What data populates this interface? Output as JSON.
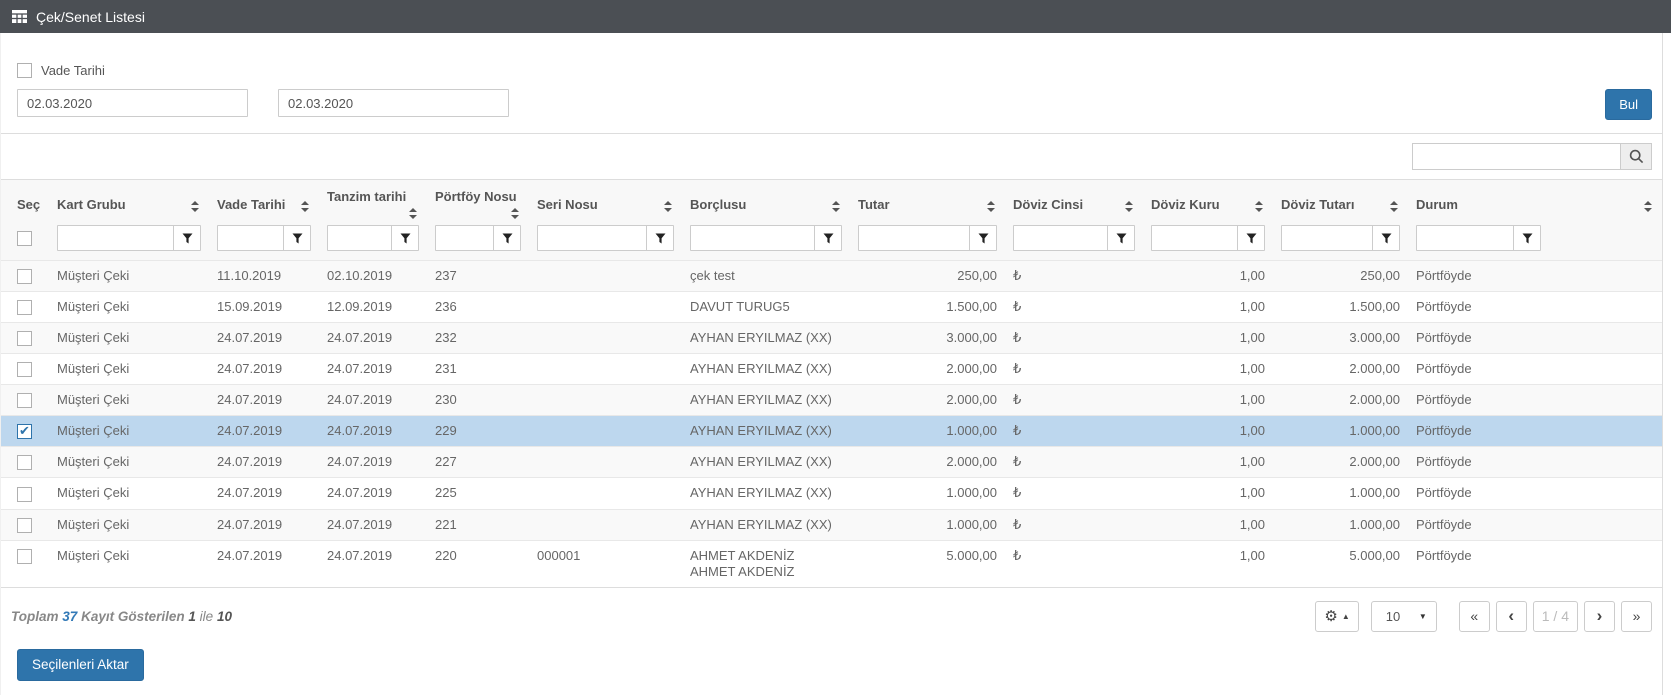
{
  "titlebar": {
    "title": "Çek/Senet Listesi",
    "icon": "table-icon",
    "bg_color": "#4b4f54"
  },
  "filters": {
    "vade_tarihi_label": "Vade Tarihi",
    "vade_tarihi_checked": false,
    "date_from": "02.03.2020",
    "date_to": "02.03.2020",
    "find_button": "Bul"
  },
  "search": {
    "value": "",
    "icon": "magnifier-icon"
  },
  "table": {
    "columns": [
      {
        "label": "Seç",
        "field": "sec",
        "sortable": false
      },
      {
        "label": "Kart Grubu",
        "field": "kart_grubu",
        "sortable": true
      },
      {
        "label": "Vade Tarihi",
        "field": "vade_tarihi",
        "sortable": true
      },
      {
        "label": "Tanzim tarihi",
        "field": "tanzim_tarihi",
        "sortable": true
      },
      {
        "label": "Pörtföy Nosu",
        "field": "portfoy_nosu",
        "sortable": true
      },
      {
        "label": "Seri Nosu",
        "field": "seri_nosu",
        "sortable": true
      },
      {
        "label": "Borçlusu",
        "field": "borclusu",
        "sortable": true
      },
      {
        "label": "Tutar",
        "field": "tutar",
        "sortable": true
      },
      {
        "label": "Döviz Cinsi",
        "field": "doviz_cinsi",
        "sortable": true
      },
      {
        "label": "Döviz Kuru",
        "field": "doviz_kuru",
        "sortable": true
      },
      {
        "label": "Döviz Tutarı",
        "field": "doviz_tutari",
        "sortable": true
      },
      {
        "label": "Durum",
        "field": "durum",
        "sortable": true
      }
    ],
    "filter_icon": "funnel-icon",
    "rows": [
      {
        "selected": false,
        "kart_grubu": "Müşteri Çeki",
        "vade_tarihi": "11.10.2019",
        "tanzim_tarihi": "02.10.2019",
        "portfoy_nosu": "237",
        "seri_nosu": "",
        "borclusu": "çek test",
        "tutar": "250,00",
        "doviz_cinsi": "₺",
        "doviz_kuru": "1,00",
        "doviz_tutari": "250,00",
        "durum": "Pörtföyde"
      },
      {
        "selected": false,
        "kart_grubu": "Müşteri Çeki",
        "vade_tarihi": "15.09.2019",
        "tanzim_tarihi": "12.09.2019",
        "portfoy_nosu": "236",
        "seri_nosu": "",
        "borclusu": "DAVUT TURUG5",
        "tutar": "1.500,00",
        "doviz_cinsi": "₺",
        "doviz_kuru": "1,00",
        "doviz_tutari": "1.500,00",
        "durum": "Pörtföyde"
      },
      {
        "selected": false,
        "kart_grubu": "Müşteri Çeki",
        "vade_tarihi": "24.07.2019",
        "tanzim_tarihi": "24.07.2019",
        "portfoy_nosu": "232",
        "seri_nosu": "",
        "borclusu": "AYHAN ERYILMAZ (XX)",
        "tutar": "3.000,00",
        "doviz_cinsi": "₺",
        "doviz_kuru": "1,00",
        "doviz_tutari": "3.000,00",
        "durum": "Pörtföyde"
      },
      {
        "selected": false,
        "kart_grubu": "Müşteri Çeki",
        "vade_tarihi": "24.07.2019",
        "tanzim_tarihi": "24.07.2019",
        "portfoy_nosu": "231",
        "seri_nosu": "",
        "borclusu": "AYHAN ERYILMAZ (XX)",
        "tutar": "2.000,00",
        "doviz_cinsi": "₺",
        "doviz_kuru": "1,00",
        "doviz_tutari": "2.000,00",
        "durum": "Pörtföyde"
      },
      {
        "selected": false,
        "kart_grubu": "Müşteri Çeki",
        "vade_tarihi": "24.07.2019",
        "tanzim_tarihi": "24.07.2019",
        "portfoy_nosu": "230",
        "seri_nosu": "",
        "borclusu": "AYHAN ERYILMAZ (XX)",
        "tutar": "2.000,00",
        "doviz_cinsi": "₺",
        "doviz_kuru": "1,00",
        "doviz_tutari": "2.000,00",
        "durum": "Pörtföyde"
      },
      {
        "selected": true,
        "kart_grubu": "Müşteri Çeki",
        "vade_tarihi": "24.07.2019",
        "tanzim_tarihi": "24.07.2019",
        "portfoy_nosu": "229",
        "seri_nosu": "",
        "borclusu": "AYHAN ERYILMAZ (XX)",
        "tutar": "1.000,00",
        "doviz_cinsi": "₺",
        "doviz_kuru": "1,00",
        "doviz_tutari": "1.000,00",
        "durum": "Pörtföyde"
      },
      {
        "selected": false,
        "kart_grubu": "Müşteri Çeki",
        "vade_tarihi": "24.07.2019",
        "tanzim_tarihi": "24.07.2019",
        "portfoy_nosu": "227",
        "seri_nosu": "",
        "borclusu": "AYHAN ERYILMAZ (XX)",
        "tutar": "2.000,00",
        "doviz_cinsi": "₺",
        "doviz_kuru": "1,00",
        "doviz_tutari": "2.000,00",
        "durum": "Pörtföyde"
      },
      {
        "selected": false,
        "kart_grubu": "Müşteri Çeki",
        "vade_tarihi": "24.07.2019",
        "tanzim_tarihi": "24.07.2019",
        "portfoy_nosu": "225",
        "seri_nosu": "",
        "borclusu": "AYHAN ERYILMAZ (XX)",
        "tutar": "1.000,00",
        "doviz_cinsi": "₺",
        "doviz_kuru": "1,00",
        "doviz_tutari": "1.000,00",
        "durum": "Pörtföyde"
      },
      {
        "selected": false,
        "kart_grubu": "Müşteri Çeki",
        "vade_tarihi": "24.07.2019",
        "tanzim_tarihi": "24.07.2019",
        "portfoy_nosu": "221",
        "seri_nosu": "",
        "borclusu": "AYHAN ERYILMAZ (XX)",
        "tutar": "1.000,00",
        "doviz_cinsi": "₺",
        "doviz_kuru": "1,00",
        "doviz_tutari": "1.000,00",
        "durum": "Pörtföyde"
      },
      {
        "selected": false,
        "kart_grubu": "Müşteri Çeki",
        "vade_tarihi": "24.07.2019",
        "tanzim_tarihi": "24.07.2019",
        "portfoy_nosu": "220",
        "seri_nosu": "000001",
        "borclusu": [
          "AHMET AKDENİZ",
          "AHMET AKDENİZ"
        ],
        "tutar": "5.000,00",
        "doviz_cinsi": "₺",
        "doviz_kuru": "1,00",
        "doviz_tutari": "5.000,00",
        "durum": "Pörtföyde"
      }
    ]
  },
  "pagination": {
    "info": {
      "word_total": "Toplam",
      "total_count": "37",
      "word_shown": "Kayıt Gösterilen",
      "from": "1",
      "word_ile": "ile",
      "to": "10"
    },
    "settings_icon": "gear-icon",
    "gear_glyph": "⚙",
    "caret_up": "▲",
    "caret_down": "▼",
    "page_size": "10",
    "first": "«",
    "prev": "‹",
    "page_indicator": "1 / 4",
    "next": "›",
    "last": "»"
  },
  "actions": {
    "export_button": "Seçilenleri Aktar"
  },
  "colors": {
    "titlebar_bg": "#4b4f54",
    "accent_blue": "#2e74ab",
    "selected_row": "#bdd7ee",
    "info_count_blue": "#337ab7"
  }
}
